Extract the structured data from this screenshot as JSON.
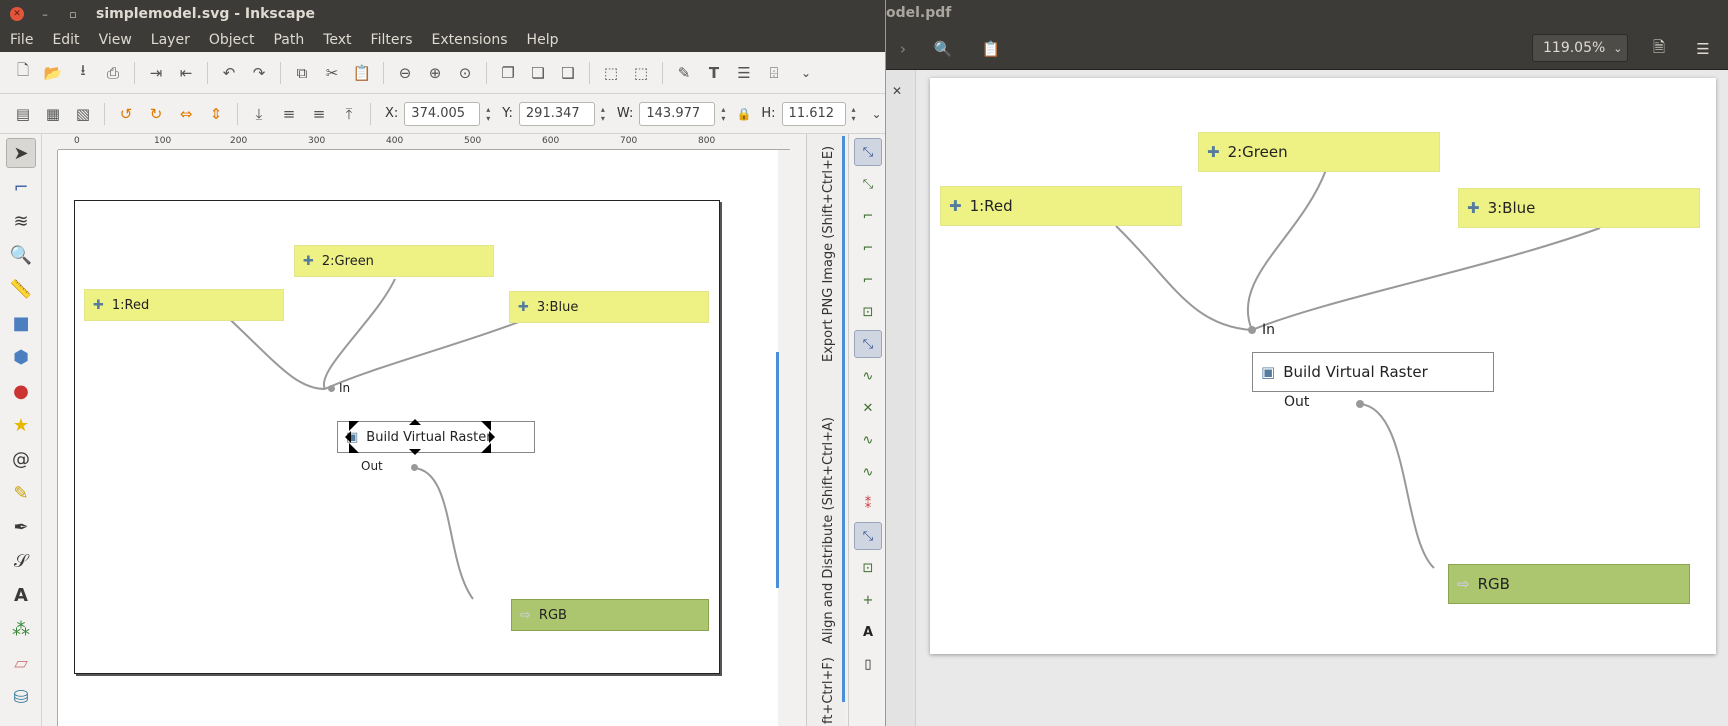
{
  "inkscape": {
    "title": "simplemodel.svg - Inkscape",
    "menu": [
      "File",
      "Edit",
      "View",
      "Layer",
      "Object",
      "Path",
      "Text",
      "Filters",
      "Extensions",
      "Help"
    ],
    "coords": {
      "x_label": "X:",
      "x_value": "374.005",
      "y_label": "Y:",
      "y_value": "291.347",
      "w_label": "W:",
      "w_value": "143.977",
      "h_label": "H:",
      "h_value": "11.612"
    },
    "ruler_labels": [
      "0",
      "100",
      "200",
      "300",
      "400",
      "500",
      "600",
      "700",
      "800"
    ],
    "docked_panels": {
      "export": "Export PNG Image (Shift+Ctrl+E)",
      "align": "Align and Distribute (Shift+Ctrl+A)",
      "fill": "ft+Ctrl+F)"
    },
    "model": {
      "red": "1:Red",
      "green": "2:Green",
      "blue": "3:Blue",
      "in": "In",
      "algorithm": "Build Virtual Raster",
      "out": "Out",
      "rgb": "RGB"
    }
  },
  "pdf": {
    "title": "odel.pdf",
    "zoom": "119.05%",
    "model": {
      "red": "1:Red",
      "green": "2:Green",
      "blue": "3:Blue",
      "in": "In",
      "algorithm": "Build Virtual Raster",
      "out": "Out",
      "rgb": "RGB"
    }
  },
  "colors": {
    "input_node": "#eef183",
    "output_node": "#abc66f",
    "titlebar": "#3c3b37",
    "accent": "#4a90d9"
  }
}
